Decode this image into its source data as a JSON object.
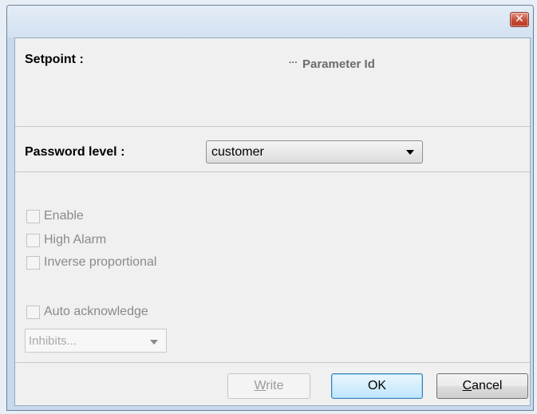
{
  "titlebar": {
    "close_glyph": "✕"
  },
  "header": {
    "setpoint_label": "Setpoint :",
    "param_dots": "···",
    "parameter_id_label": "Parameter Id"
  },
  "password": {
    "label": "Password level :",
    "selected": "customer"
  },
  "options": [
    {
      "label": "Enable",
      "checked": false,
      "enabled": false
    },
    {
      "label": "High Alarm",
      "checked": false,
      "enabled": false
    },
    {
      "label": "Inverse proportional",
      "checked": false,
      "enabled": false
    },
    {
      "label": "Auto acknowledge",
      "checked": false,
      "enabled": false
    }
  ],
  "inhibits": {
    "placeholder": "Inhibits..."
  },
  "buttons": {
    "write_mnemonic": "W",
    "write_rest": "rite",
    "ok": "OK",
    "cancel_mnemonic": "C",
    "cancel_rest": "ancel"
  },
  "colors": {
    "window_frame": "#c7d9ec",
    "close_button": "#c9503b",
    "client_bg": "#f0f0f0",
    "disabled_text": "#8a8a8a",
    "ok_accent": "#3c7fb1"
  }
}
